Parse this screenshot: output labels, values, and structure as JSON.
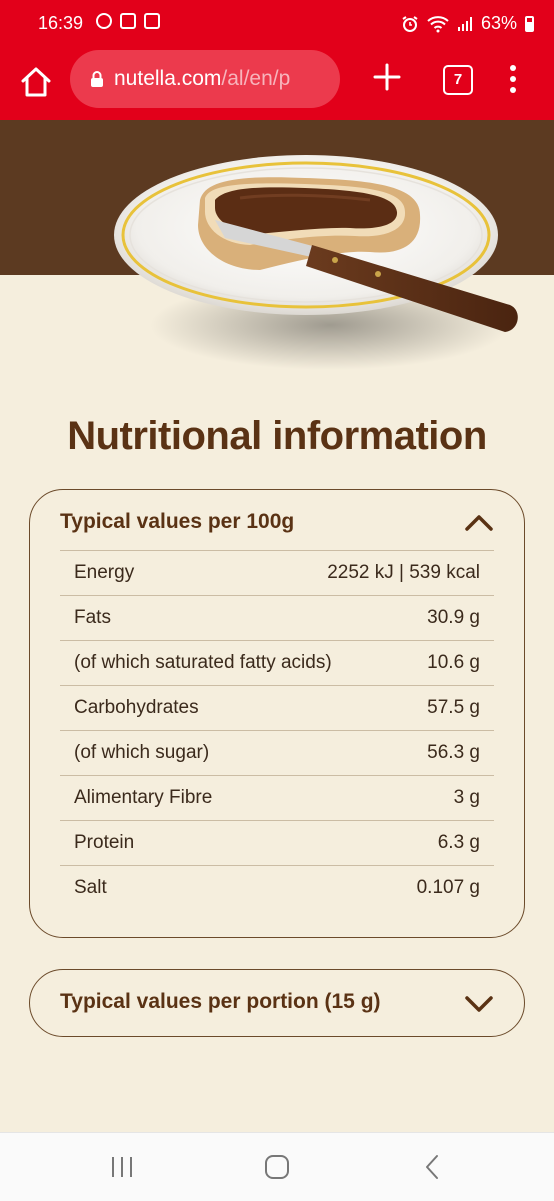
{
  "status_bar": {
    "time": "16:39",
    "battery": "63%",
    "icons": [
      "sync-icon",
      "app-notification-icon",
      "app-notification-icon",
      "alarm-icon",
      "wifi-icon",
      "signal-icon",
      "battery-icon"
    ]
  },
  "browser": {
    "url_host": "nutella.com",
    "url_path": "/al/en/p",
    "tab_count": "7",
    "colors": {
      "toolbar": "#e2001a",
      "urlbar": "#ec3a4d"
    }
  },
  "page": {
    "title": "Nutritional information",
    "colors": {
      "background": "#f5eedd",
      "brown_band": "#5c3a21",
      "heading": "#5a3214"
    }
  },
  "panel_100g": {
    "heading": "Typical values per 100g",
    "expanded": true,
    "rows": [
      {
        "label": "Energy",
        "value": "2252 kJ | 539 kcal"
      },
      {
        "label": "Fats",
        "value": "30.9 g"
      },
      {
        "label": "(of which saturated fatty acids)",
        "value": "10.6 g"
      },
      {
        "label": "Carbohydrates",
        "value": "57.5 g"
      },
      {
        "label": "(of which sugar)",
        "value": "56.3 g"
      },
      {
        "label": "Alimentary Fibre",
        "value": "3 g"
      },
      {
        "label": "Protein",
        "value": "6.3 g"
      },
      {
        "label": "Salt",
        "value": "0.107 g"
      }
    ]
  },
  "panel_portion": {
    "heading": "Typical values per portion (15 g)",
    "expanded": false
  },
  "nav_bar": {
    "items": [
      "recent-apps-icon",
      "home-icon",
      "back-icon"
    ]
  }
}
